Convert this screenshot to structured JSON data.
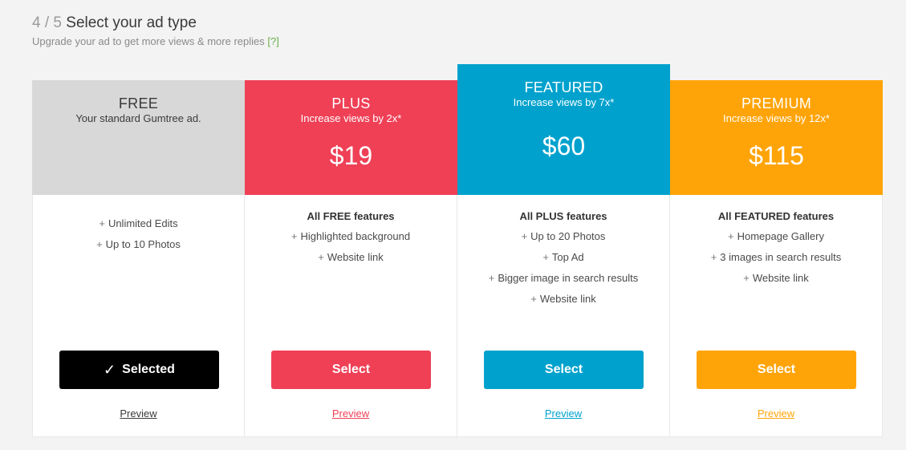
{
  "header": {
    "step": "4 / 5",
    "title": "Select your ad type",
    "subtitle": "Upgrade your ad to get more views & more replies",
    "help_link": "[?]"
  },
  "colors": {
    "free": "#d8d8d8",
    "plus": "#ef4056",
    "featured": "#00a2cd",
    "premium": "#ffa408",
    "selected_button": "#000000",
    "help_link": "#6ab04c"
  },
  "plans": [
    {
      "name": "FREE",
      "tagline": "Your standard Gumtree ad.",
      "price": "",
      "includes": "",
      "features": [
        "Unlimited Edits",
        "Up to 10 Photos"
      ],
      "button_label": "Selected",
      "selected": true,
      "preview_label": "Preview"
    },
    {
      "name": "PLUS",
      "tagline": "Increase views by 2x*",
      "price": "$19",
      "includes": "All FREE features",
      "features": [
        "Highlighted background",
        "Website link"
      ],
      "button_label": "Select",
      "selected": false,
      "preview_label": "Preview"
    },
    {
      "name": "FEATURED",
      "tagline": "Increase views by 7x*",
      "price": "$60",
      "includes": "All PLUS features",
      "features": [
        "Up to 20 Photos",
        "Top Ad",
        "Bigger image in search results",
        "Website link"
      ],
      "button_label": "Select",
      "selected": false,
      "preview_label": "Preview"
    },
    {
      "name": "PREMIUM",
      "tagline": "Increase views by 12x*",
      "price": "$115",
      "includes": "All FEATURED features",
      "features": [
        "Homepage Gallery",
        "3 images in search results",
        "Website link"
      ],
      "button_label": "Select",
      "selected": false,
      "preview_label": "Preview"
    }
  ],
  "icons": {
    "plus_bullet": "+",
    "check": "✓"
  }
}
